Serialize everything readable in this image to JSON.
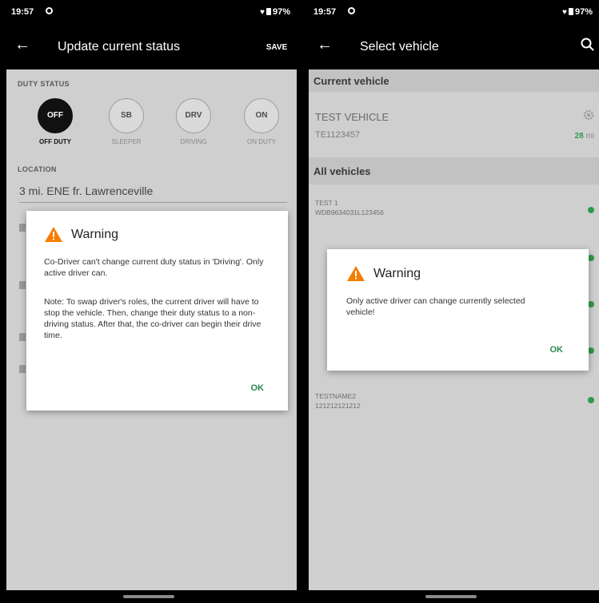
{
  "left": {
    "status_bar": {
      "time": "19:57",
      "battery": "97%"
    },
    "app_bar": {
      "back_icon": "arrow-left-icon",
      "title": "Update current status",
      "action": "SAVE"
    },
    "duty_status": {
      "label": "DUTY STATUS",
      "items": [
        {
          "code": "OFF",
          "caption": "OFF DUTY",
          "active": true
        },
        {
          "code": "SB",
          "caption": "SLEEPER",
          "active": false
        },
        {
          "code": "DRV",
          "caption": "DRIVING",
          "active": false
        },
        {
          "code": "ON",
          "caption": "ON DUTY",
          "active": false
        }
      ]
    },
    "location": {
      "label": "LOCATION",
      "value": "3 mi. ENE fr. Lawrenceville"
    },
    "dialog": {
      "icon": "warning-icon",
      "title": "Warning",
      "message1": "Co-Driver can't change current duty status in 'Driving'. Only active driver can.",
      "message2": "Note: To swap driver's roles, the current driver will have to stop the vehicle. Then, change their duty status to a non-driving status. After that, the co-driver can begin their drive time.",
      "ok": "OK"
    }
  },
  "right": {
    "status_bar": {
      "time": "19:57",
      "battery": "97%"
    },
    "app_bar": {
      "back_icon": "arrow-left-icon",
      "title": "Select vehicle",
      "search_icon": "search-icon"
    },
    "current_vehicle": {
      "header": "Current vehicle",
      "name": "TEST VEHICLE",
      "vin": "TE1123457",
      "miles_value": "28",
      "miles_unit": "mi"
    },
    "all_vehicles": {
      "header": "All vehicles",
      "items": [
        {
          "name": "TEST 1",
          "vin": "WDB9634031L123456"
        },
        {
          "name": "TESTNAME2",
          "vin": "121212121212"
        }
      ]
    },
    "dialog": {
      "icon": "warning-icon",
      "title": "Warning",
      "message": "Only active driver can change currently selected vehicle!",
      "ok": "OK"
    }
  },
  "colors": {
    "accent_green": "#2f9a4a",
    "dark": "#000000",
    "dim_background": "#cfcfcf",
    "warning_orange": "#f57c00"
  }
}
